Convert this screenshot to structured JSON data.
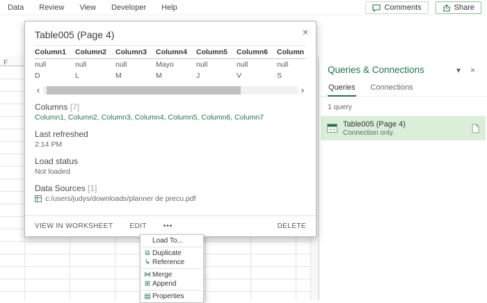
{
  "menu": {
    "items": [
      "Data",
      "Review",
      "View",
      "Developer",
      "Help"
    ]
  },
  "topbar": {
    "comments_label": "Comments",
    "share_label": "Share"
  },
  "worksheet": {
    "column_header": "F"
  },
  "peek": {
    "title": "Table005 (Page 4)",
    "close_icon": "×",
    "table": {
      "headers": [
        "Column1",
        "Column2",
        "Column3",
        "Column4",
        "Column5",
        "Column6",
        "Column"
      ],
      "rows": [
        [
          "null",
          "null",
          "null",
          "Mayo",
          "null",
          "null",
          "null"
        ],
        [
          "D",
          "L",
          "M",
          "M",
          "J",
          "V",
          "S"
        ]
      ]
    },
    "scrollbar": {
      "left_arrow": "‹",
      "right_arrow": "›"
    },
    "columns_section": {
      "label": "Columns",
      "count": "[7]",
      "links": "Column1, Column2, Column3, Column4, Column5, Column6, Column7"
    },
    "last_refreshed": {
      "label": "Last refreshed",
      "value": "2:14 PM"
    },
    "load_status": {
      "label": "Load status",
      "value": "Not loaded"
    },
    "data_sources": {
      "label": "Data Sources",
      "count": "[1]",
      "value": "c:/users/judys/downloads/planner de precu.pdf"
    },
    "actions": {
      "view": "VIEW IN WORKSHEET",
      "edit": "EDIT",
      "more": "•••",
      "delete": "DELETE"
    }
  },
  "context_menu": {
    "items": [
      {
        "label": "Load To...",
        "icon": ""
      },
      {
        "label": "Duplicate",
        "icon": "⧉"
      },
      {
        "label": "Reference",
        "icon": "↳"
      },
      {
        "label": "Merge",
        "icon": "⋈"
      },
      {
        "label": "Append",
        "icon": "⊞"
      },
      {
        "label": "Properties",
        "icon": "▤"
      }
    ]
  },
  "panel": {
    "title": "Queries & Connections",
    "collapse_icon": "▾",
    "close_icon": "×",
    "tabs": [
      {
        "label": "Queries"
      },
      {
        "label": "Connections"
      }
    ],
    "count": "1 query",
    "query": {
      "name": "Table005 (Page 4)",
      "status": "Connection only."
    }
  },
  "colors": {
    "accent_green": "#217346",
    "query_highlight": "#daeeda"
  }
}
